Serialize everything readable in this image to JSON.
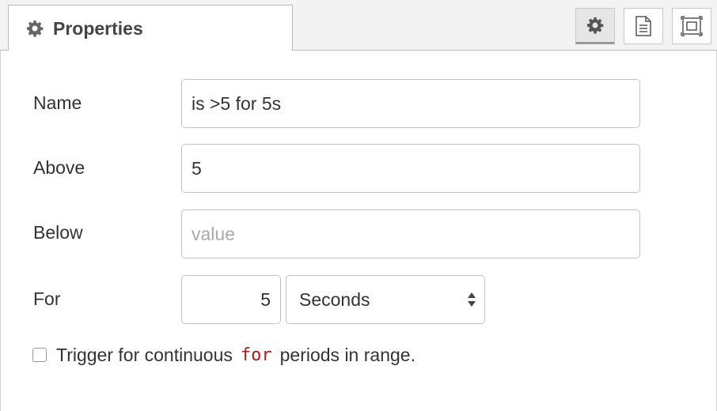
{
  "tab": {
    "label": "Properties",
    "icon": "gear-icon"
  },
  "toolbar": {
    "buttons": [
      {
        "name": "properties-tab-button",
        "icon": "gear-icon",
        "active": true
      },
      {
        "name": "description-tab-button",
        "icon": "document-icon",
        "active": false
      },
      {
        "name": "appearance-tab-button",
        "icon": "frame-icon",
        "active": false
      }
    ]
  },
  "form": {
    "name": {
      "label": "Name",
      "value": "is >5 for 5s",
      "placeholder": ""
    },
    "above": {
      "label": "Above",
      "value": "5",
      "placeholder": ""
    },
    "below": {
      "label": "Below",
      "value": "",
      "placeholder": "value"
    },
    "for": {
      "label": "For",
      "value": "5",
      "unit": "Seconds"
    },
    "continuous": {
      "checked": false,
      "text_before": "Trigger for continuous",
      "code": "for",
      "text_after": "periods in range."
    }
  },
  "colors": {
    "code": "#a02020",
    "border": "#c4c4c4",
    "tab_bg": "#f3f3f3"
  }
}
